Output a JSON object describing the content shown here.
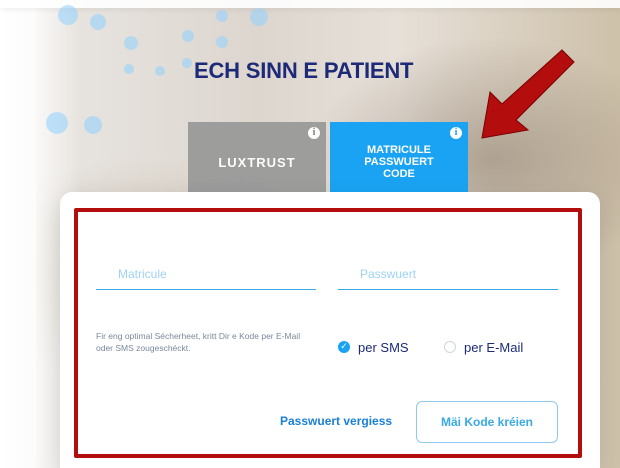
{
  "colors": {
    "title": "#1d2a78",
    "tab_active": "#1aa3f2",
    "tab_inactive": "#9a9a9a",
    "field_line": "#39a9e6",
    "placeholder": "#9fd2f2",
    "highlight": "#b30d0d"
  },
  "header": {
    "title": "ECH SINN E PATIENT"
  },
  "tabs": [
    {
      "label": "LUXTRUST",
      "icon": "info-icon",
      "active": false
    },
    {
      "label_lines": [
        "MATRICULE",
        "PASSWUERT",
        "CODE"
      ],
      "icon": "info-icon",
      "active": true
    }
  ],
  "form": {
    "matricule_placeholder": "Matricule",
    "passwuert_placeholder": "Passwuert",
    "security_hint": "Fir eng optimal Sécherheet, kritt Dir e Kode per E-Mail oder SMS zougeschéckt.",
    "options": {
      "sms_label": "per SMS",
      "email_label": "per E-Mail",
      "selected": "per SMS"
    },
    "forgot_password_link": "Passwuert vergiess",
    "create_code_button": "Mäi Kode kréien"
  },
  "annotations": {
    "highlight": "red-outline-box",
    "arrow": "red-arrow-icon"
  }
}
